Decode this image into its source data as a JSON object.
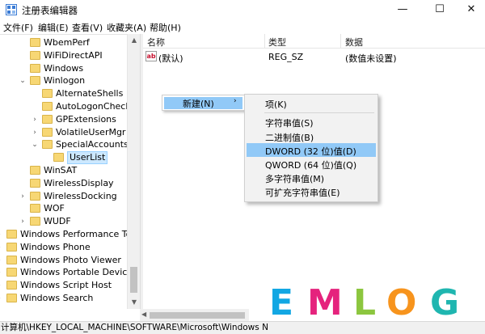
{
  "window": {
    "title": "注册表编辑器",
    "minimize_glyph": "—",
    "maximize_glyph": "☐",
    "close_glyph": "✕",
    "app_icon": "registry-editor-icon"
  },
  "menu": [
    "文件(F)",
    "编辑(E)",
    "查看(V)",
    "收藏夹(A)",
    "帮助(H)"
  ],
  "tree": {
    "items": [
      {
        "label": "WbemPerf",
        "chevron": "",
        "level": 2
      },
      {
        "label": "WiFiDirectAPI",
        "chevron": "",
        "level": 2
      },
      {
        "label": "Windows",
        "chevron": "",
        "level": 2
      },
      {
        "label": "Winlogon",
        "chevron": "v",
        "level": 2
      },
      {
        "label": "AlternateShells",
        "chevron": "",
        "level": 3
      },
      {
        "label": "AutoLogonCheck",
        "chevron": "",
        "level": 3
      },
      {
        "label": "GPExtensions",
        "chevron": ">",
        "level": 3
      },
      {
        "label": "VolatileUserMgr",
        "chevron": ">",
        "level": 3
      },
      {
        "label": "SpecialAccounts",
        "chevron": "v",
        "level": 3
      },
      {
        "label": "UserList",
        "chevron": "",
        "level": 4,
        "selected": true
      },
      {
        "label": "WinSAT",
        "chevron": "",
        "level": 2
      },
      {
        "label": "WirelessDisplay",
        "chevron": "",
        "level": 2
      },
      {
        "label": "WirelessDocking",
        "chevron": ">",
        "level": 2
      },
      {
        "label": "WOF",
        "chevron": "",
        "level": 2
      },
      {
        "label": "WUDF",
        "chevron": ">",
        "level": 2
      },
      {
        "label": "Windows Performance Too",
        "chevron": ">",
        "level": 1
      },
      {
        "label": "Windows Phone",
        "chevron": ">",
        "level": 1
      },
      {
        "label": "Windows Photo Viewer",
        "chevron": ">",
        "level": 1
      },
      {
        "label": "Windows Portable Devices",
        "chevron": ">",
        "level": 1
      },
      {
        "label": "Windows Script Host",
        "chevron": ">",
        "level": 1
      },
      {
        "label": "Windows Search",
        "chevron": ">",
        "level": 1
      }
    ]
  },
  "list": {
    "headers": {
      "name": "名称",
      "type": "类型",
      "data": "数据"
    },
    "rows": [
      {
        "icon_text": "ab",
        "name": "(默认)",
        "type": "REG_SZ",
        "data": "(数值未设置)"
      }
    ]
  },
  "context_menu": {
    "new_label": "新建(N)",
    "new_arrow": "›"
  },
  "submenu": {
    "items": [
      {
        "label": "项(K)"
      },
      {
        "label": "字符串值(S)"
      },
      {
        "label": "二进制值(B)"
      },
      {
        "label": "DWORD (32 位)值(D)",
        "highlighted": true
      },
      {
        "label": "QWORD (64 位)值(Q)"
      },
      {
        "label": "多字符串值(M)"
      },
      {
        "label": "可扩充字符串值(E)"
      }
    ]
  },
  "status_bar": {
    "path": "计算机\\HKEY_LOCAL_MACHINE\\SOFTWARE\\Microsoft\\Windows N"
  },
  "watermark": {
    "letters": [
      {
        "char": "E",
        "color": "#12a7e3"
      },
      {
        "char": "M",
        "color": "#e5237d"
      },
      {
        "char": "L",
        "color": "#8cc63f"
      },
      {
        "char": "O",
        "color": "#f7941d"
      },
      {
        "char": "G",
        "color": "#1fb6b0"
      }
    ]
  },
  "colors": {
    "selection": "#cce8ff",
    "menu_highlight": "#91c9f7",
    "folder": "#f7d774"
  }
}
